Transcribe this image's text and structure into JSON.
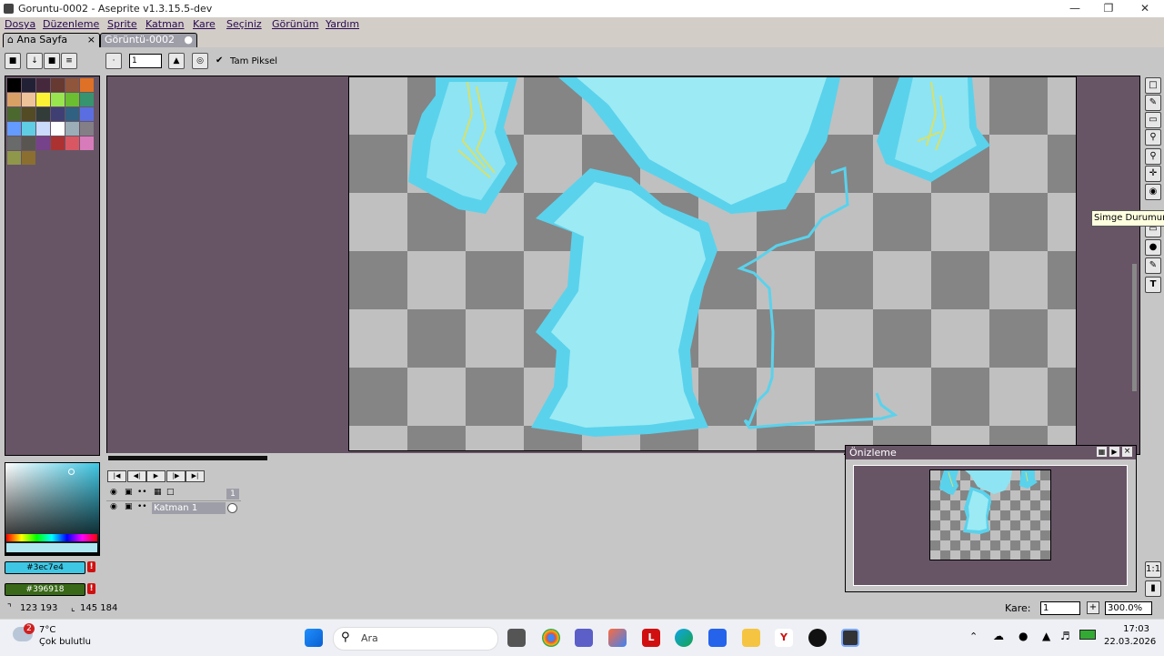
{
  "window": {
    "title": "Goruntu-0002 - Aseprite v1.3.15.5-dev"
  },
  "menu": [
    "Dosya",
    "Düzenleme",
    "Sprite",
    "Katman",
    "Kare",
    "Seçiniz",
    "Görünüm",
    "Yardım"
  ],
  "tabs": [
    {
      "label": "Ana Sayfa"
    },
    {
      "label": "Görüntü-0002"
    }
  ],
  "toolbar": {
    "brush_size": "1",
    "pixel_perfect_label": "Tam Piksel"
  },
  "tooltip": "Simge Durumuna",
  "timeline": {
    "frame_number": "1",
    "layer_name": "Katman 1"
  },
  "preview": {
    "title": "Önizleme"
  },
  "colors": {
    "foreground": "#3ec7e4",
    "background": "#396918",
    "fg_swatch": "#3ec7e4",
    "bg_swatch": "#396918",
    "window_bg": "#675566"
  },
  "statusbar": {
    "coords": "123 193",
    "size": "145 184",
    "frame_label": "Kare:",
    "frame_value": "1",
    "zoom": "300.0%"
  },
  "taskbar": {
    "weather_temp": "7°C",
    "weather_desc": "Çok bulutlu",
    "weather_badge": "2",
    "search_placeholder": "Ara",
    "time": "17:03",
    "date": "22.03.2026"
  }
}
